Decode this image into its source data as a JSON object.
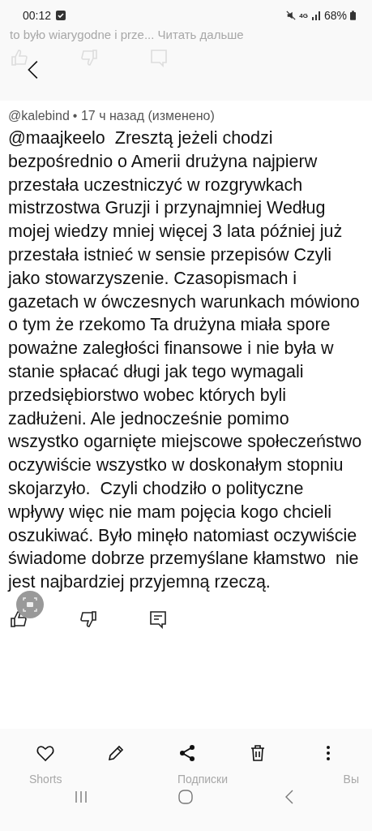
{
  "status_bar": {
    "time": "00:12",
    "network": "4G",
    "battery": "68%"
  },
  "background_page": {
    "preview_text": "to było wiarygodne i prze... Читать дальше",
    "nav_labels": [
      "Shorts",
      "Подписки",
      "Вы"
    ]
  },
  "comment": {
    "author": "@kalebind",
    "meta": "• 17 ч назад (изменено)",
    "text": "@maajkeelo  Zresztą jeżeli chodzi bezpośrednio o Amerii drużyna najpierw przestała uczestniczyć w rozgrywkach mistrzostwa Gruzji i przynajmniej Według mojej wiedzy mniej więcej 3 lata później już przestała istnieć w sensie przepisów Czyli jako stowarzyszenie. Czasopismach i gazetach w ówczesnych warunkach mówiono o tym że rzekomo Ta drużyna miała spore poważne zaległości finansowe i nie była w stanie spłacać długi jak tego wymagali przedsiębiorstwo wobec których byli zadłużeni. Ale jednocześnie pomimo wszystko ogarnięte miejscowe społeczeństwo oczywiście wszystko w doskonałym stopniu skojarzyło.  Czyli chodziło o polityczne wpływy więc nie mam pojęcia kogo chcieli oszukiwać. Było minęło natomiast oczywiście świadome dobrze przemyślane kłamstwo  nie jest najbardziej przyjemną rzeczą."
  }
}
